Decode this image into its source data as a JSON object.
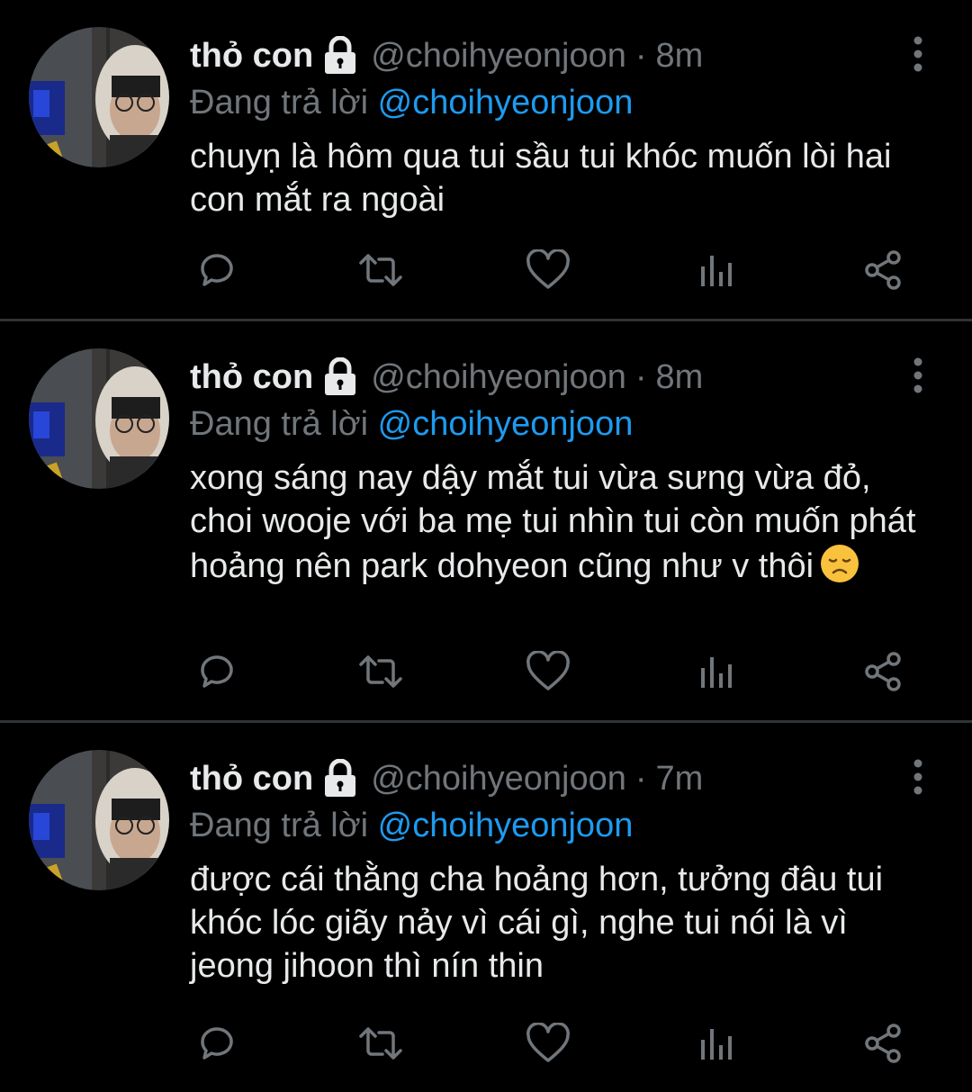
{
  "colors": {
    "background": "#000000",
    "primary_text": "#e7e9ea",
    "secondary_text": "#71767b",
    "accent": "#1d9bf0",
    "divider": "#2f3336"
  },
  "tweets": [
    {
      "name": "thỏ con",
      "handle": "@choihyeonjoon",
      "separator": "·",
      "time": "8m",
      "reply_prefix": "Đang trả lời",
      "reply_mention": "@choihyeonjoon",
      "text": "chuyṇ là hôm qua tui sầu tui khóc muốn lòi hai con mắt ra ngoài",
      "emoji": ""
    },
    {
      "name": "thỏ con",
      "handle": "@choihyeonjoon",
      "separator": "·",
      "time": "8m",
      "reply_prefix": "Đang trả lời",
      "reply_mention": "@choihyeonjoon",
      "text": "xong sáng nay dậy mắt tui vừa sưng vừa đỏ, choi wooje với ba mẹ tui nhìn tui còn muốn phát hoảng nên park dohyeon cũng như v thôi",
      "emoji": "disappointed-face"
    },
    {
      "name": "thỏ con",
      "handle": "@choihyeonjoon",
      "separator": "·",
      "time": "7m",
      "reply_prefix": "Đang trả lời",
      "reply_mention": "@choihyeonjoon",
      "text": "được cái thằng cha hoảng hơn, tưởng đâu tui khóc lóc giãy nảy vì cái gì, nghe tui nói là vì jeong jihoon thì nín thin",
      "emoji": ""
    }
  ],
  "icons": {
    "lock": "lock-icon",
    "more": "more-vertical-icon",
    "reply": "comment-icon",
    "retweet": "retweet-icon",
    "like": "heart-icon",
    "views": "analytics-icon",
    "share": "share-icon"
  }
}
